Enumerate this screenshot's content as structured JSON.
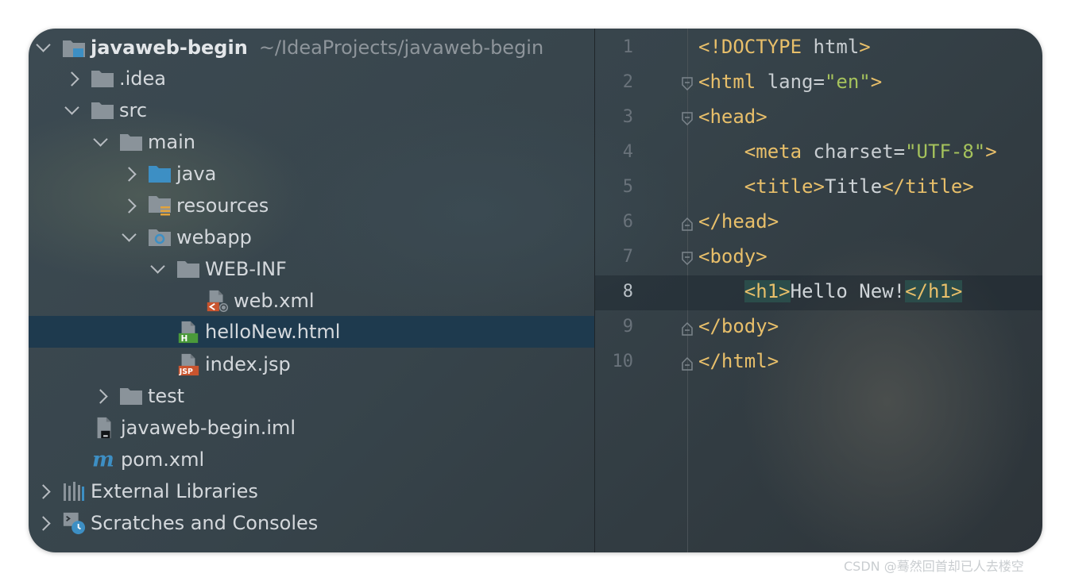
{
  "project_tree": {
    "root": {
      "label": "javaweb-begin",
      "path": "~/IdeaProjects/javaweb-begin"
    },
    "items": [
      {
        "label": ".idea"
      },
      {
        "label": "src"
      },
      {
        "label": "main"
      },
      {
        "label": "java"
      },
      {
        "label": "resources"
      },
      {
        "label": "webapp"
      },
      {
        "label": "WEB-INF"
      },
      {
        "label": "web.xml"
      },
      {
        "label": "helloNew.html"
      },
      {
        "label": "index.jsp"
      },
      {
        "label": "test"
      },
      {
        "label": "javaweb-begin.iml"
      },
      {
        "label": "pom.xml"
      },
      {
        "label": "External Libraries"
      },
      {
        "label": "Scratches and Consoles"
      }
    ],
    "selected": "helloNew.html",
    "icon_labels": {
      "html": "H",
      "jsp": "JSP",
      "maven": "m"
    }
  },
  "editor": {
    "current_line": 8,
    "lines": [
      {
        "n": "1",
        "p1": "<!DOCTYPE",
        "p2": " html",
        "p3": ">"
      },
      {
        "n": "2",
        "p1": "<html",
        "p2": " lang",
        "p3": "=",
        "p4": "\"en\"",
        "p5": ">"
      },
      {
        "n": "3",
        "p1": "<head>"
      },
      {
        "n": "4",
        "p1": "<meta",
        "p2": " charset",
        "p3": "=",
        "p4": "\"UTF-8\"",
        "p5": ">"
      },
      {
        "n": "5",
        "p1": "<title>",
        "p2": "Title",
        "p3": "</title>"
      },
      {
        "n": "6",
        "p1": "</head>"
      },
      {
        "n": "7",
        "p1": "<body>"
      },
      {
        "n": "8",
        "p1": "<h1>",
        "p2": "Hello New!",
        "p3": "</h1>"
      },
      {
        "n": "9",
        "p1": "</body>"
      },
      {
        "n": "10",
        "p1": "</html>"
      }
    ]
  },
  "watermark": "CSDN @蓦然回首却已人去楼空",
  "colors": {
    "tag": "#e8bf6a",
    "attr_value": "#a5c25c",
    "selection": "#1e3a4e",
    "folder": "#8a939a",
    "source_folder": "#3d8fc4"
  }
}
